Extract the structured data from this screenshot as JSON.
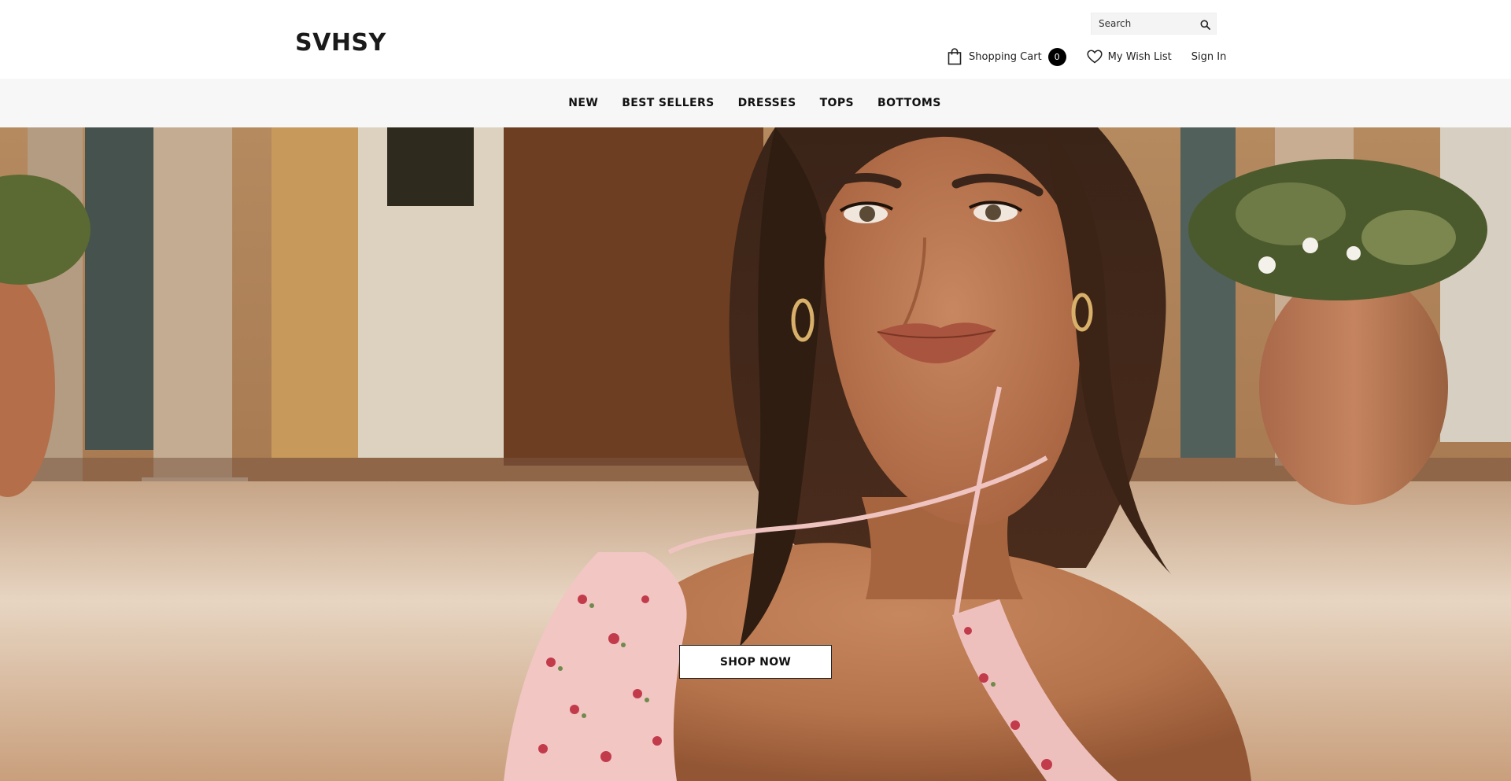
{
  "brand": {
    "logo": "SVHSY"
  },
  "search": {
    "placeholder": "Search",
    "icon": "search-icon"
  },
  "header_links": {
    "cart_label": "Shopping Cart",
    "cart_count": "0",
    "cart_icon": "shopping-bag-icon",
    "wishlist_label": "My Wish List",
    "wishlist_icon": "heart-icon",
    "signin_label": "Sign In"
  },
  "nav": {
    "items": [
      {
        "label": "NEW"
      },
      {
        "label": "BEST SELLERS"
      },
      {
        "label": "DRESSES"
      },
      {
        "label": "TOPS"
      },
      {
        "label": "BOTTOMS"
      }
    ]
  },
  "hero": {
    "cta_label": "SHOP NOW"
  },
  "colors": {
    "header_bg": "#ffffff",
    "nav_bg": "#f7f7f7",
    "text": "#111111",
    "badge_bg": "#000000",
    "button_bg": "#ffffff"
  }
}
